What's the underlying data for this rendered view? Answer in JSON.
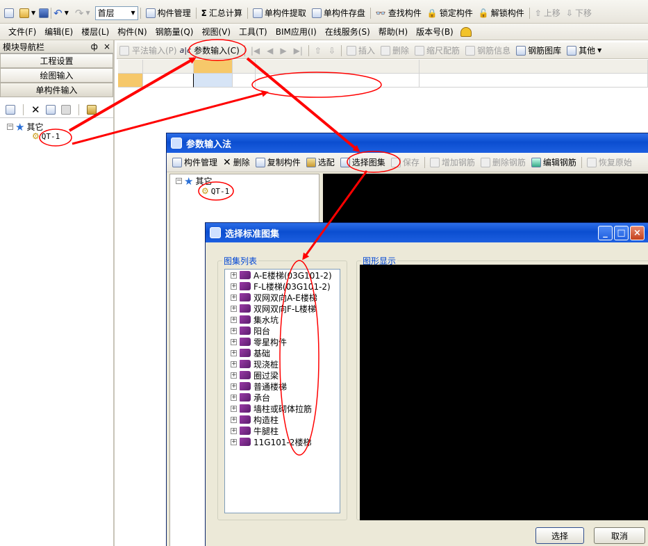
{
  "main_toolbar": {
    "floor": "首层",
    "items": [
      {
        "label": "构件管理",
        "icon": "component-manage-icon"
      },
      {
        "label": "汇总计算",
        "icon": "sigma-icon"
      },
      {
        "label": "单构件提取",
        "icon": "extract-icon"
      },
      {
        "label": "单构件存盘",
        "icon": "save-component-icon"
      },
      {
        "label": "查找构件",
        "icon": "binoculars-icon"
      },
      {
        "label": "锁定构件",
        "icon": "lock-icon"
      },
      {
        "label": "解锁构件",
        "icon": "unlock-icon"
      },
      {
        "label": "上移",
        "icon": "up-arrow-icon",
        "disabled": true
      },
      {
        "label": "下移",
        "icon": "down-arrow-icon",
        "disabled": true
      }
    ]
  },
  "menubar": {
    "items": [
      "文件(F)",
      "编辑(E)",
      "楼层(L)",
      "构件(N)",
      "钢筋量(Q)",
      "视图(V)",
      "工具(T)",
      "BIM应用(I)",
      "在线服务(S)",
      "帮助(H)",
      "版本号(B)"
    ]
  },
  "nav": {
    "title": "模块导航栏",
    "pin": "ф",
    "close": "×",
    "buttons": [
      "工程设置",
      "绘图输入",
      "单构件输入"
    ],
    "tree": {
      "root": "其它",
      "child": "QT-1"
    }
  },
  "component_toolbar": {
    "items": [
      {
        "label": "平法输入(P)",
        "disabled": true
      },
      {
        "label": "参数输入(C)",
        "disabled": false
      },
      {
        "label": "插入",
        "disabled": true
      },
      {
        "label": "删除",
        "disabled": true
      },
      {
        "label": "缩尺配筋",
        "disabled": true
      },
      {
        "label": "钢筋信息",
        "disabled": true
      },
      {
        "label": "钢筋图库",
        "disabled": false
      },
      {
        "label": "其他",
        "disabled": false
      }
    ]
  },
  "param_window": {
    "title": "参数输入法",
    "toolbar": [
      {
        "label": "构件管理",
        "disabled": false
      },
      {
        "label": "删除",
        "disabled": false
      },
      {
        "label": "复制构件",
        "disabled": false
      },
      {
        "label": "选配",
        "disabled": false
      },
      {
        "label": "选择图集",
        "disabled": false
      },
      {
        "label": "保存",
        "disabled": true
      },
      {
        "label": "增加钢筋",
        "disabled": true
      },
      {
        "label": "删除钢筋",
        "disabled": true
      },
      {
        "label": "编辑钢筋",
        "disabled": false
      },
      {
        "label": "恢复原始",
        "disabled": true
      }
    ],
    "tree": {
      "root": "其它",
      "child": "QT-1"
    }
  },
  "atlas_dialog": {
    "title": "选择标准图集",
    "list_group": "图集列表",
    "preview_group": "图形显示",
    "items": [
      "A-E楼梯(03G101-2)",
      "F-L楼梯(03G101-2)",
      "双网双向A-E楼梯",
      "双网双向F-L楼梯",
      "集水坑",
      "阳台",
      "零星构件",
      "基础",
      "现浇桩",
      "圈过梁",
      "普通楼梯",
      "承台",
      "墙柱或砌体拉筋",
      "构造柱",
      "牛腿柱",
      "11G101-2楼梯"
    ],
    "select_btn": "选择",
    "cancel_btn": "取消"
  },
  "annotation_color": "#ff0000"
}
